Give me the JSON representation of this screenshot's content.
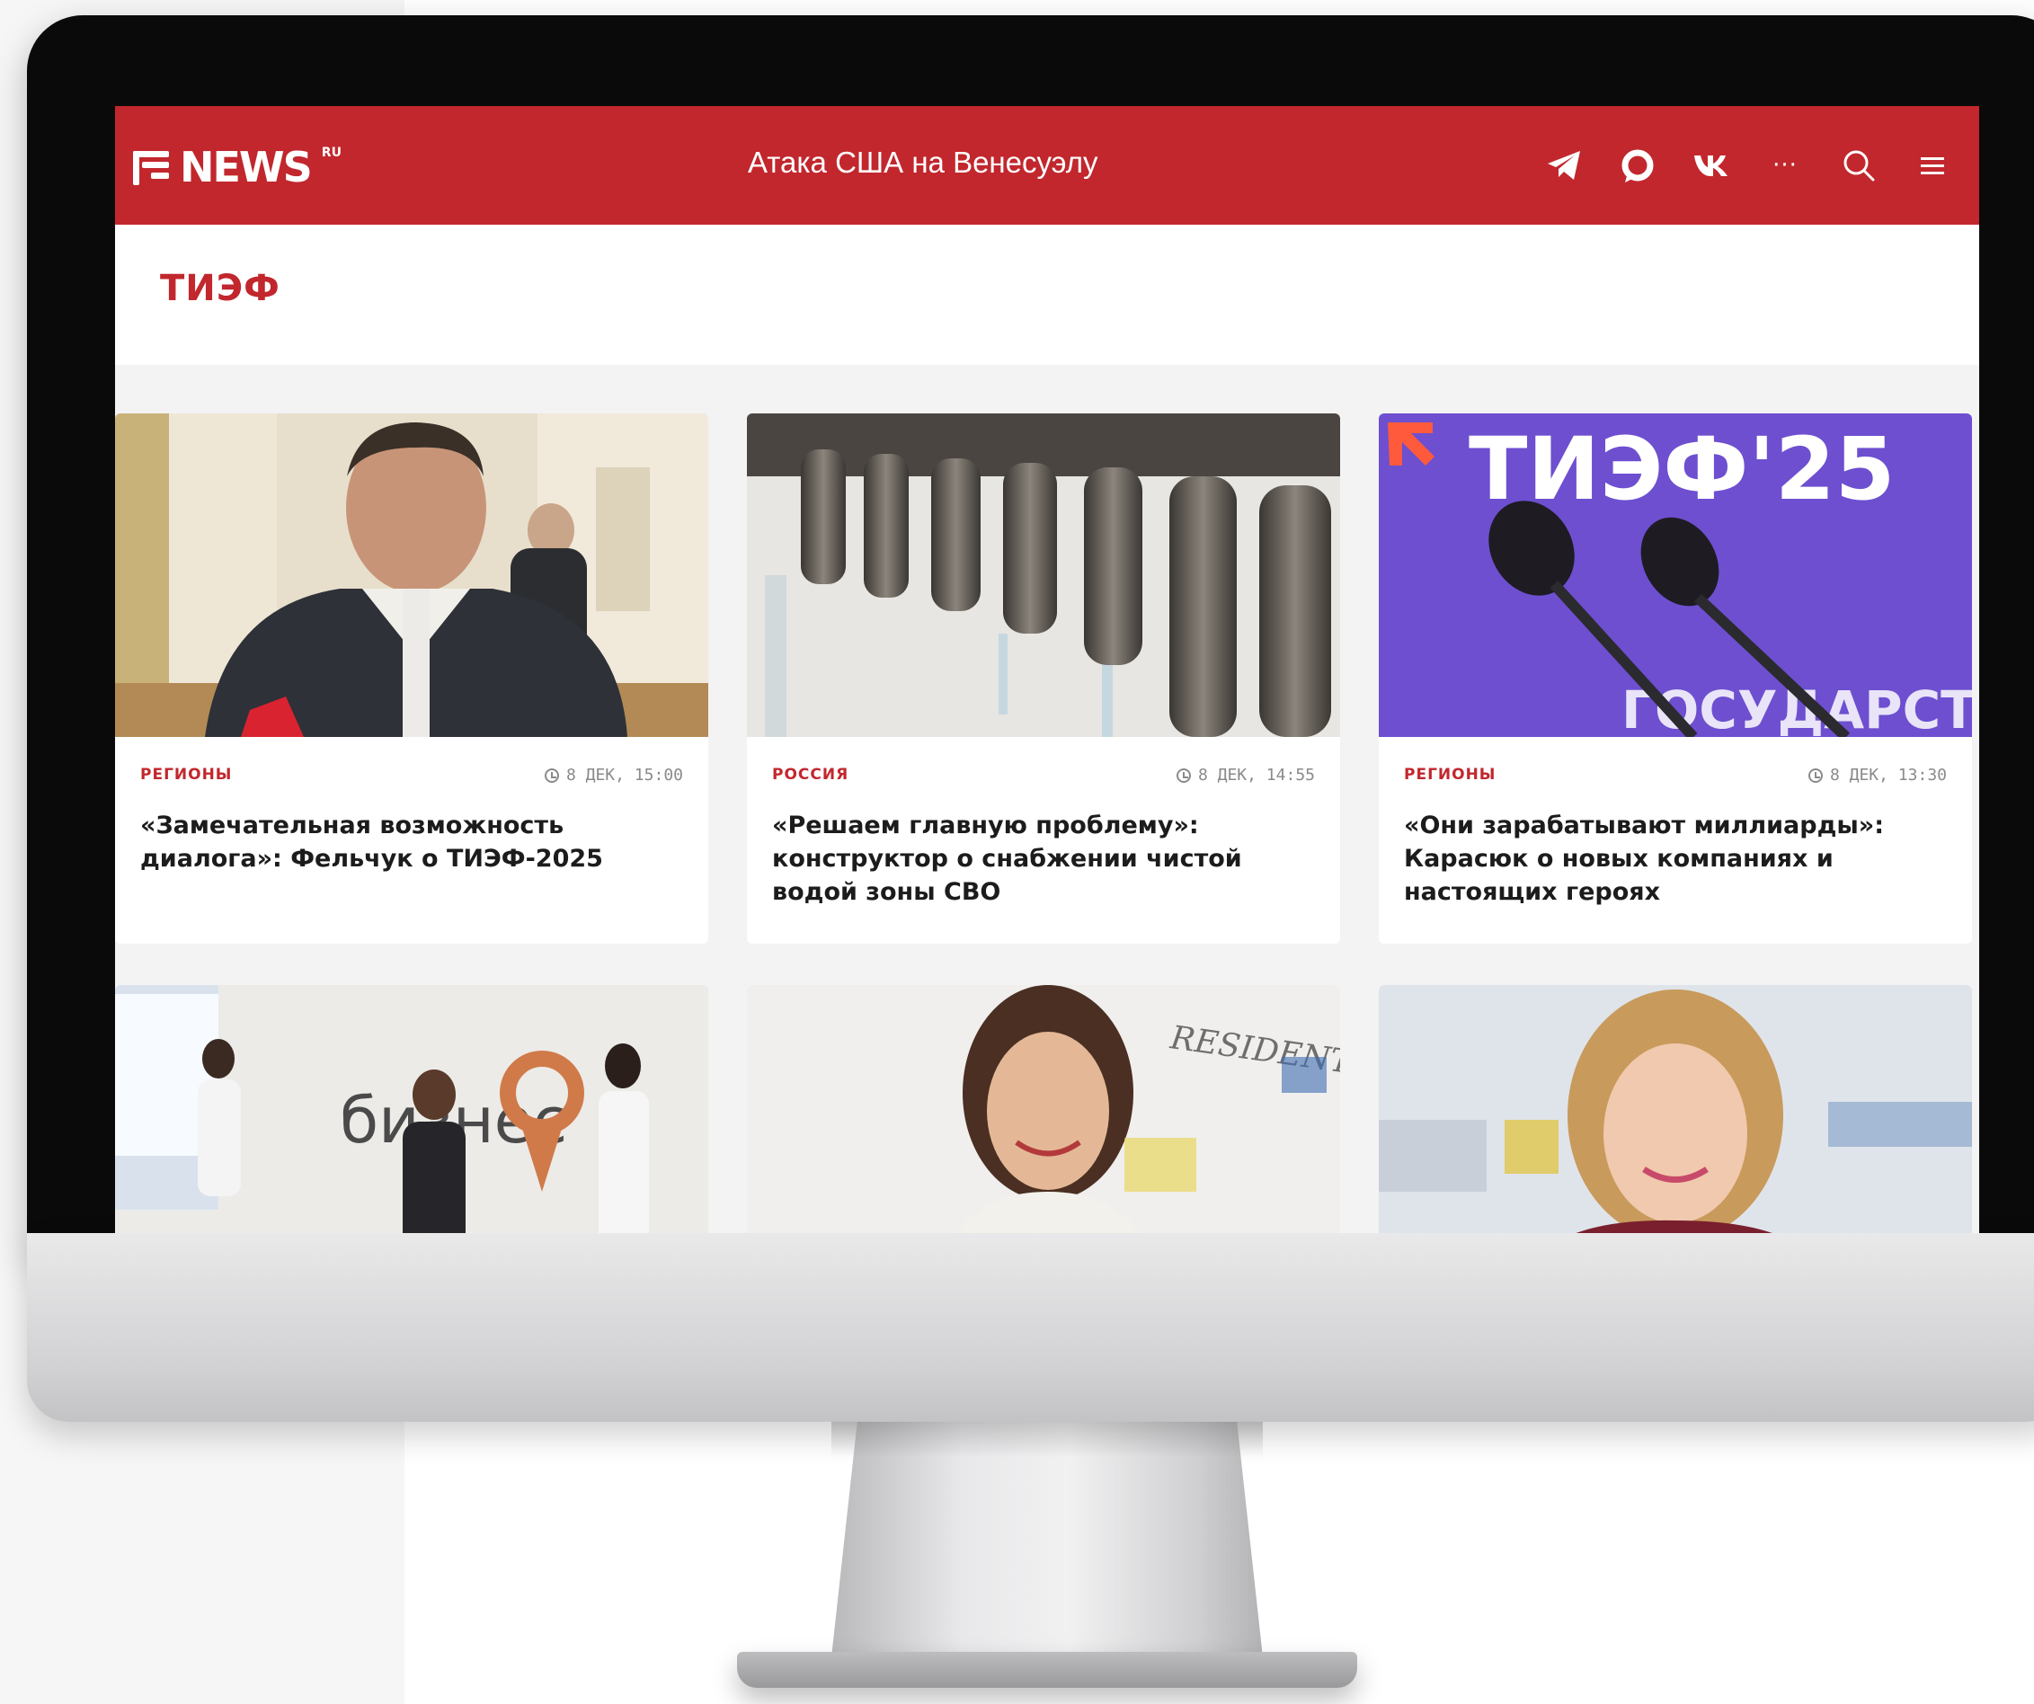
{
  "header": {
    "logo_text": "NEWS",
    "logo_sup": "RU",
    "headline_link": "Атака США на Венесуэлу",
    "icons": [
      "telegram-icon",
      "max-messenger-icon",
      "vk-icon",
      "more-icon",
      "search-icon",
      "menu-icon"
    ],
    "more_label": "···"
  },
  "section": {
    "title": "ТИЭФ"
  },
  "articles": [
    {
      "category": "РЕГИОНЫ",
      "time": "8 ДЕК, 15:00",
      "title": "«Замечательная возможность диалога»: Фельчук о ТИЭФ-2025",
      "image": "man-interview-photo"
    },
    {
      "category": "РОССИЯ",
      "time": "8 ДЕК, 14:55",
      "title": "«Решаем главную проблему»: конструктор о снабжении чистой водой зоны СВО",
      "image": "water-taps-photo"
    },
    {
      "category": "РЕГИОНЫ",
      "time": "8 ДЕК, 13:30",
      "title": "«Они зарабатывают миллиарды»: Карасюк о новых компаниях и настоящих героях",
      "image": "microphones-photo",
      "image_text": "ТИЭФ'25",
      "image_text2": "ГОСУДАРСТВО"
    },
    {
      "image": "business-expo-photo",
      "image_text": "бизнес"
    },
    {
      "image": "woman-smiling-photo",
      "image_text": "RESIDENT"
    },
    {
      "image": "woman-portrait-photo"
    }
  ],
  "colors": {
    "brand_red": "#c1272d",
    "screen_bg": "#f3f3f4",
    "card_bg": "#ffffff"
  }
}
